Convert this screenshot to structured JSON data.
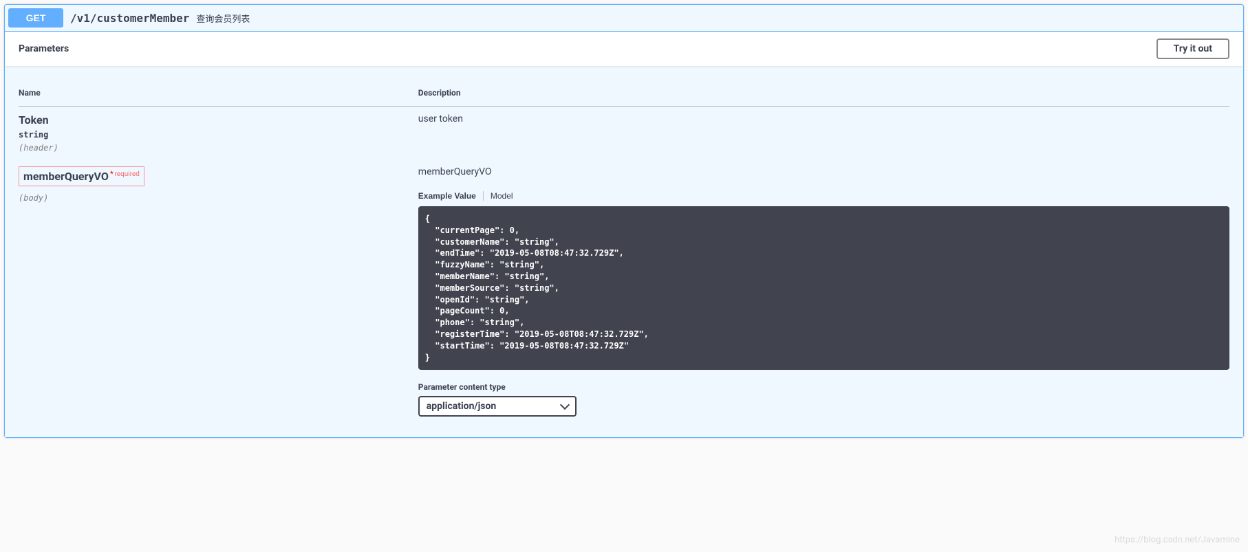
{
  "operation": {
    "method": "GET",
    "path": "/v1/customerMember",
    "summary": "查询会员列表"
  },
  "section": {
    "parametersTitle": "Parameters",
    "tryItOut": "Try it out"
  },
  "table": {
    "headers": {
      "name": "Name",
      "description": "Description"
    }
  },
  "params": [
    {
      "name": "Token",
      "type": "string",
      "in": "(header)",
      "required": false,
      "description": "user token"
    },
    {
      "name": "memberQueryVO",
      "type": "",
      "in": "(body)",
      "required": true,
      "requiredLabel": "required",
      "description": "memberQueryVO"
    }
  ],
  "tabs": {
    "example": "Example Value",
    "model": "Model"
  },
  "exampleJson": "{\n  \"currentPage\": 0,\n  \"customerName\": \"string\",\n  \"endTime\": \"2019-05-08T08:47:32.729Z\",\n  \"fuzzyName\": \"string\",\n  \"memberName\": \"string\",\n  \"memberSource\": \"string\",\n  \"openId\": \"string\",\n  \"pageCount\": 0,\n  \"phone\": \"string\",\n  \"registerTime\": \"2019-05-08T08:47:32.729Z\",\n  \"startTime\": \"2019-05-08T08:47:32.729Z\"\n}",
  "contentType": {
    "label": "Parameter content type",
    "selected": "application/json",
    "options": [
      "application/json"
    ]
  },
  "watermark": "https://blog.csdn.net/Javamine"
}
